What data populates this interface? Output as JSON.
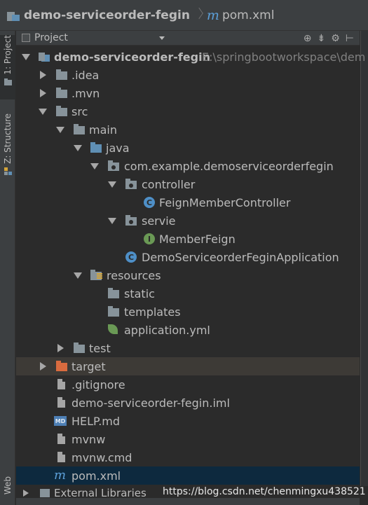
{
  "breadcrumb": {
    "project": "demo-serviceorder-fegin",
    "file_icon_letter": "m",
    "file": "pom.xml"
  },
  "toolstrip": {
    "project_tab": "1: Project",
    "structure_tab": "Z: Structure",
    "web_tab": "Web"
  },
  "panel": {
    "title": "Project",
    "tool_icons": [
      "target-icon",
      "collapse-icon",
      "gear-icon",
      "hide-icon"
    ]
  },
  "tree": {
    "root": {
      "name": "demo-serviceorder-fegin",
      "path": "E:\\springbootworkspace\\dem"
    },
    "idea": ".idea",
    "mvn": ".mvn",
    "src": "src",
    "main": "main",
    "java": "java",
    "package": "com.example.demoserviceorderfegin",
    "controller": "controller",
    "controller_class": "FeignMemberController",
    "servie": "servie",
    "interface": "MemberFeign",
    "app": "DemoServiceorderFeginApplication",
    "resources": "resources",
    "static": "static",
    "templates": "templates",
    "yml": "application.yml",
    "test": "test",
    "target": "target",
    "gitignore": ".gitignore",
    "iml": "demo-serviceorder-fegin.iml",
    "help": "HELP.md",
    "help_badge": "MD",
    "mvnw": "mvnw",
    "mvnwcmd": "mvnw.cmd",
    "pom": "pom.xml",
    "external": "External Libraries"
  },
  "watermark": "https://blog.csdn.net/chenmingxu438521",
  "colors": {
    "background": "#2b2b2b",
    "selection": "#0d293e",
    "excluded": "#3d3a36",
    "folder_blue": "#5f8fb4",
    "folder_orange": "#d96b3f"
  }
}
